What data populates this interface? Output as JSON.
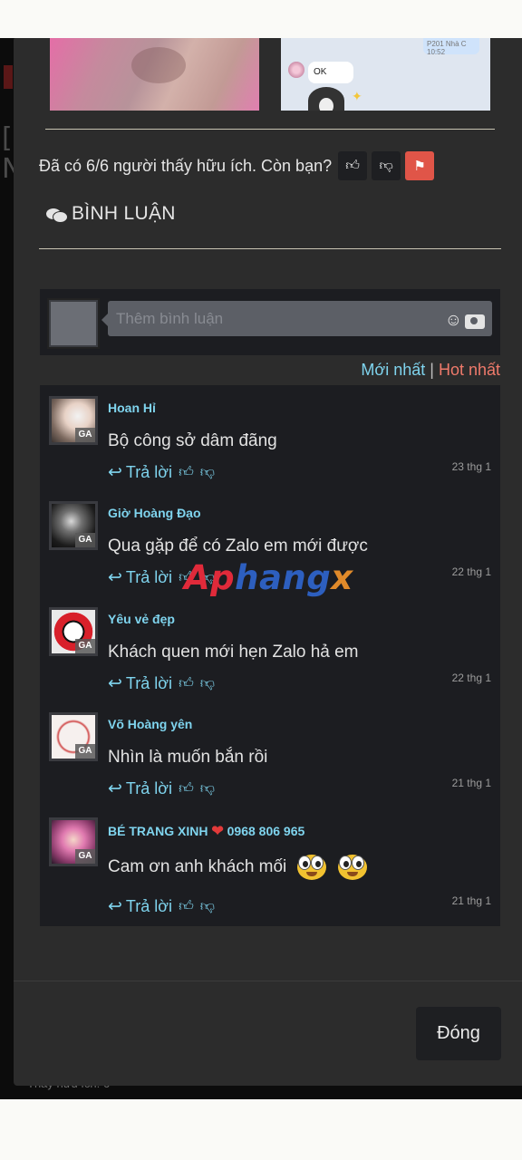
{
  "background": {
    "bracket": "[\nN",
    "under_text": "Thấy hữu ích: 6"
  },
  "photos": {
    "chat_bubble_right": "P201 Nhà C\n10:52",
    "chat_bubble_left": "OK"
  },
  "helpful": {
    "text": "Đã có 6/6 người thấy hữu ích. Còn bạn?"
  },
  "comments_section": {
    "title": "BÌNH LUẬN",
    "placeholder": "Thêm bình luận",
    "sort_newest": "Mới nhất",
    "sort_separator": "|",
    "sort_hot": "Hot nhất",
    "reply_label": "Trả lời",
    "badge": "GA",
    "items": [
      {
        "name": "Hoan Hỉ",
        "text": "Bộ công sở dâm đãng",
        "date": "23 thg 1"
      },
      {
        "name": "Giờ Hoàng Đạo",
        "text": "Qua gặp để có Zalo em mới được",
        "date": "22 thg 1"
      },
      {
        "name": "Yêu vẻ đẹp",
        "text": "Khách quen mới hẹn Zalo hả em",
        "date": "22 thg 1"
      },
      {
        "name": "Võ Hoàng yên",
        "text": "Nhìn là muốn bắn rồi",
        "date": "21 thg 1"
      },
      {
        "name": "BÉ TRANG XINH",
        "name_suffix": "0968 806 965",
        "text": "Cam ơn anh khách mối",
        "date": "21 thg 1"
      }
    ]
  },
  "watermark": {
    "part1": "Ap",
    "part2": "hang",
    "part3": "x"
  },
  "footer": {
    "close_label": "Đóng"
  }
}
